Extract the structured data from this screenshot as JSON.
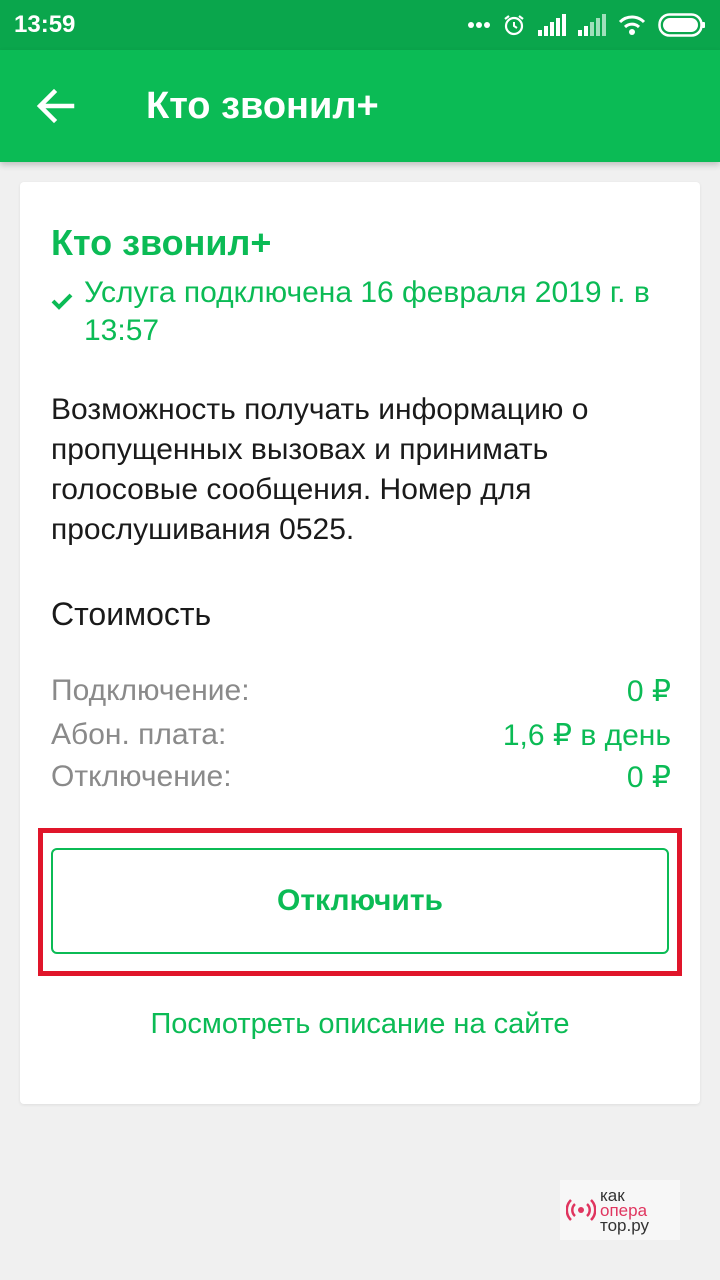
{
  "status_bar": {
    "time": "13:59"
  },
  "app_bar": {
    "title": "Кто звонил+"
  },
  "service": {
    "title": "Кто звонил+",
    "status": "Услуга подключена 16 февраля 2019 г. в 13:57",
    "description": "Возможность получать информацию о пропущенных вызовах и принимать голосовые сообщения. Номер для прослушивания 0525."
  },
  "cost": {
    "heading": "Стоимость",
    "rows": [
      {
        "label": "Подключение:",
        "value": "0 ₽"
      },
      {
        "label": "Абон. плата:",
        "value": "1,6 ₽ в день"
      },
      {
        "label": "Отключение:",
        "value": "0 ₽"
      }
    ]
  },
  "actions": {
    "disable_label": "Отключить",
    "site_link": "Посмотреть описание на сайте"
  },
  "watermark": {
    "line1": "как",
    "line2": "опера",
    "line3": "тор.ру"
  },
  "colors": {
    "brand_green": "#0bbb55",
    "status_bar": "#0aa64c",
    "highlight_red": "#e0152a"
  }
}
